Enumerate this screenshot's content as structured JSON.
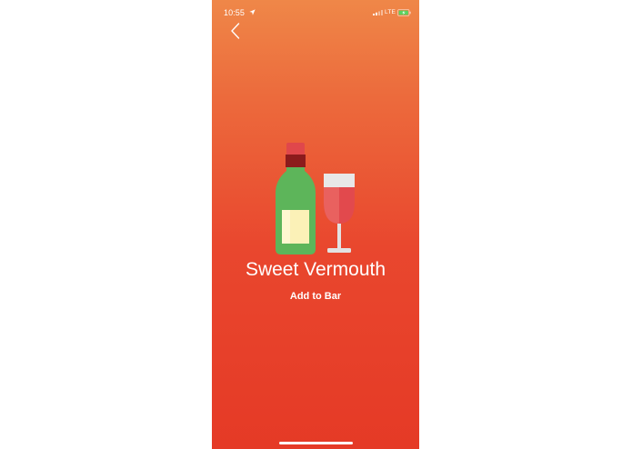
{
  "status_bar": {
    "time": "10:55",
    "network": "LTE",
    "icons": [
      "location-arrow-icon",
      "cellular-signal-icon",
      "battery-charging-icon"
    ]
  },
  "nav": {
    "back_icon": "chevron-left-icon"
  },
  "item": {
    "name": "Sweet Vermouth",
    "action_label": "Add to Bar",
    "illustration": "wine-bottle-and-glass-icon"
  },
  "colors": {
    "gradient_top": "#ef8748",
    "gradient_bottom": "#e53a26",
    "bottle_green": "#5db55a",
    "wine_red": "#e2494d",
    "text": "#ffffff"
  }
}
